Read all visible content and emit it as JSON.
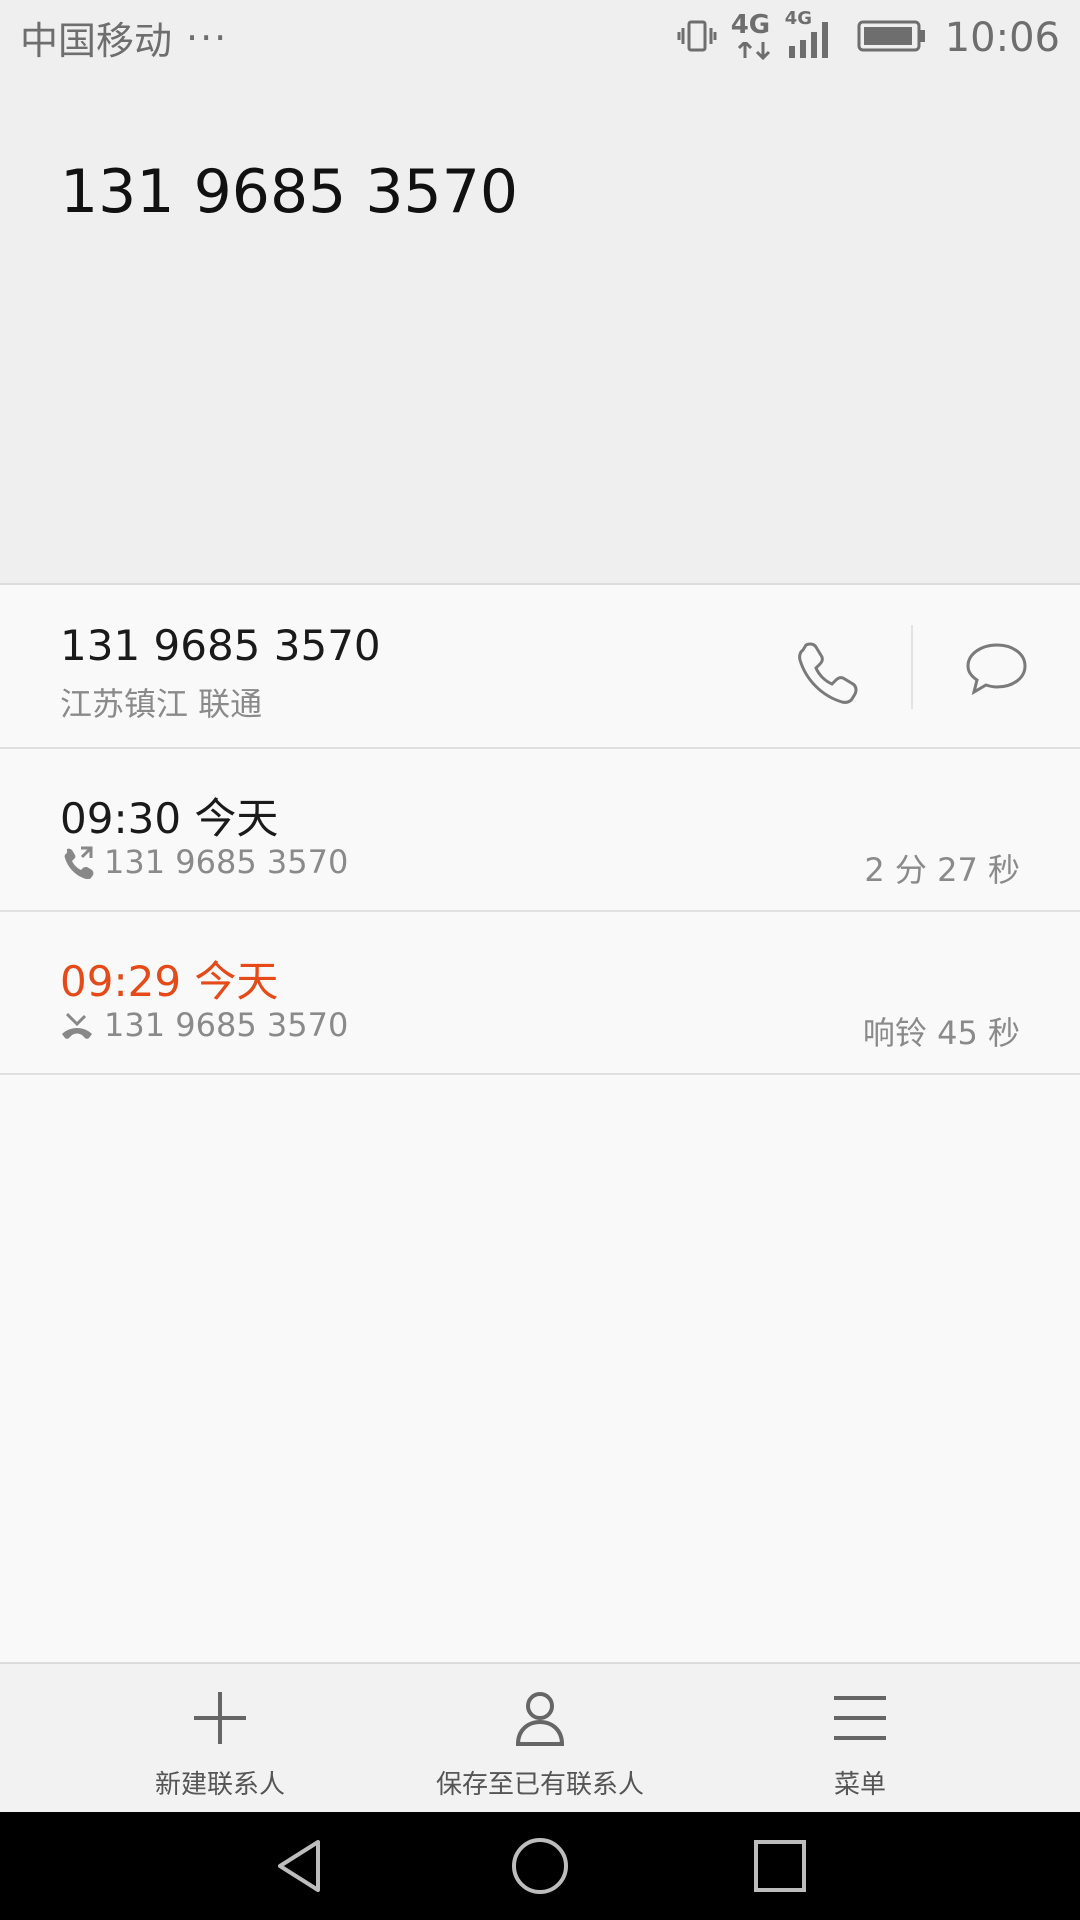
{
  "status_bar": {
    "carrier": "中国移动",
    "dots": "···",
    "network_1": "4G",
    "network_2": "4G",
    "time": "10:06"
  },
  "header": {
    "number": "131 9685 3570"
  },
  "number_row": {
    "number": "131 9685 3570",
    "location": "江苏镇江 联通"
  },
  "calls": [
    {
      "time": "09:30 今天",
      "number": "131 9685 3570",
      "duration": "2 分 27 秒",
      "type": "outgoing",
      "color": "#1a1a1a"
    },
    {
      "time": "09:29 今天",
      "number": "131 9685 3570",
      "duration": "响铃 45 秒",
      "type": "missed",
      "color": "#e64a19"
    }
  ],
  "toolbar": {
    "new_contact": "新建联系人",
    "save_existing": "保存至已有联系人",
    "menu": "菜单"
  }
}
